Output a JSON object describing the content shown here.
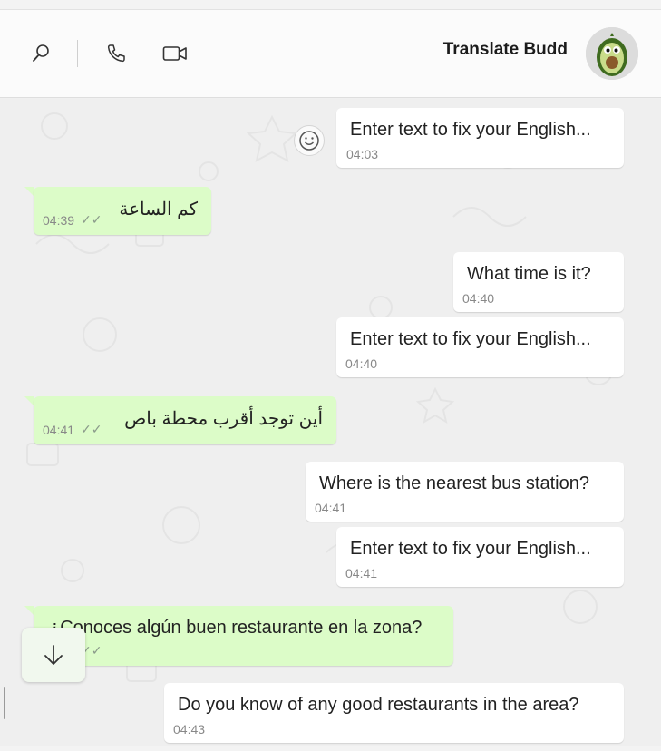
{
  "header": {
    "title": "Translate Budd",
    "icons": [
      "search-icon",
      "phone-icon",
      "video-icon"
    ],
    "avatar": "avocado-avatar"
  },
  "messages": [
    {
      "dir": "in",
      "text": "Enter text to fix your English...",
      "time": "04:03"
    },
    {
      "dir": "out",
      "text": "كم الساعة",
      "time": "04:39"
    },
    {
      "dir": "in",
      "text": "What time is it?",
      "time": "04:40"
    },
    {
      "dir": "in",
      "text": "Enter text to fix your English...",
      "time": "04:40"
    },
    {
      "dir": "out",
      "text": "أين توجد أقرب محطة باص",
      "time": "04:41"
    },
    {
      "dir": "in",
      "text": "Where is the nearest bus station?",
      "time": "04:41"
    },
    {
      "dir": "in",
      "text": "Enter text to fix your English...",
      "time": "04:41"
    },
    {
      "dir": "out",
      "text": "¿Conoces algún buen restaurante en la zona?",
      "time": ""
    },
    {
      "dir": "in",
      "text": "Do you know of any good restaurants in the area?",
      "time": "04:43"
    }
  ],
  "ticks": "✓✓",
  "colors": {
    "incoming": "#ffffff",
    "outgoing": "#dcfcc8",
    "background": "#efefef"
  }
}
